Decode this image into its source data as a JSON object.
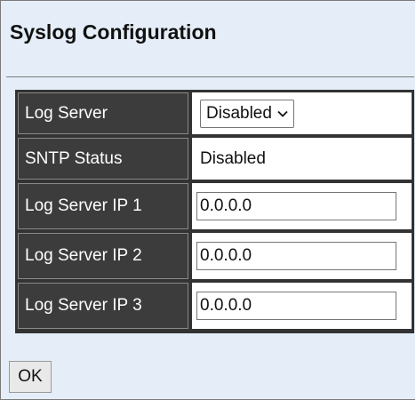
{
  "page": {
    "title": "Syslog Configuration"
  },
  "form": {
    "rows": [
      {
        "label": "Log Server",
        "type": "select",
        "value": "Disabled"
      },
      {
        "label": "SNTP Status",
        "type": "text",
        "value": "Disabled"
      },
      {
        "label": "Log Server IP 1",
        "type": "input",
        "value": "0.0.0.0"
      },
      {
        "label": "Log Server IP 2",
        "type": "input",
        "value": "0.0.0.0"
      },
      {
        "label": "Log Server IP 3",
        "type": "input",
        "value": "0.0.0.0"
      }
    ]
  },
  "actions": {
    "ok_label": "OK"
  },
  "colors": {
    "page_background": "#e5eef8",
    "table_border": "#333333",
    "label_cell_background": "#3c3c3c",
    "label_text": "#ffffff"
  }
}
